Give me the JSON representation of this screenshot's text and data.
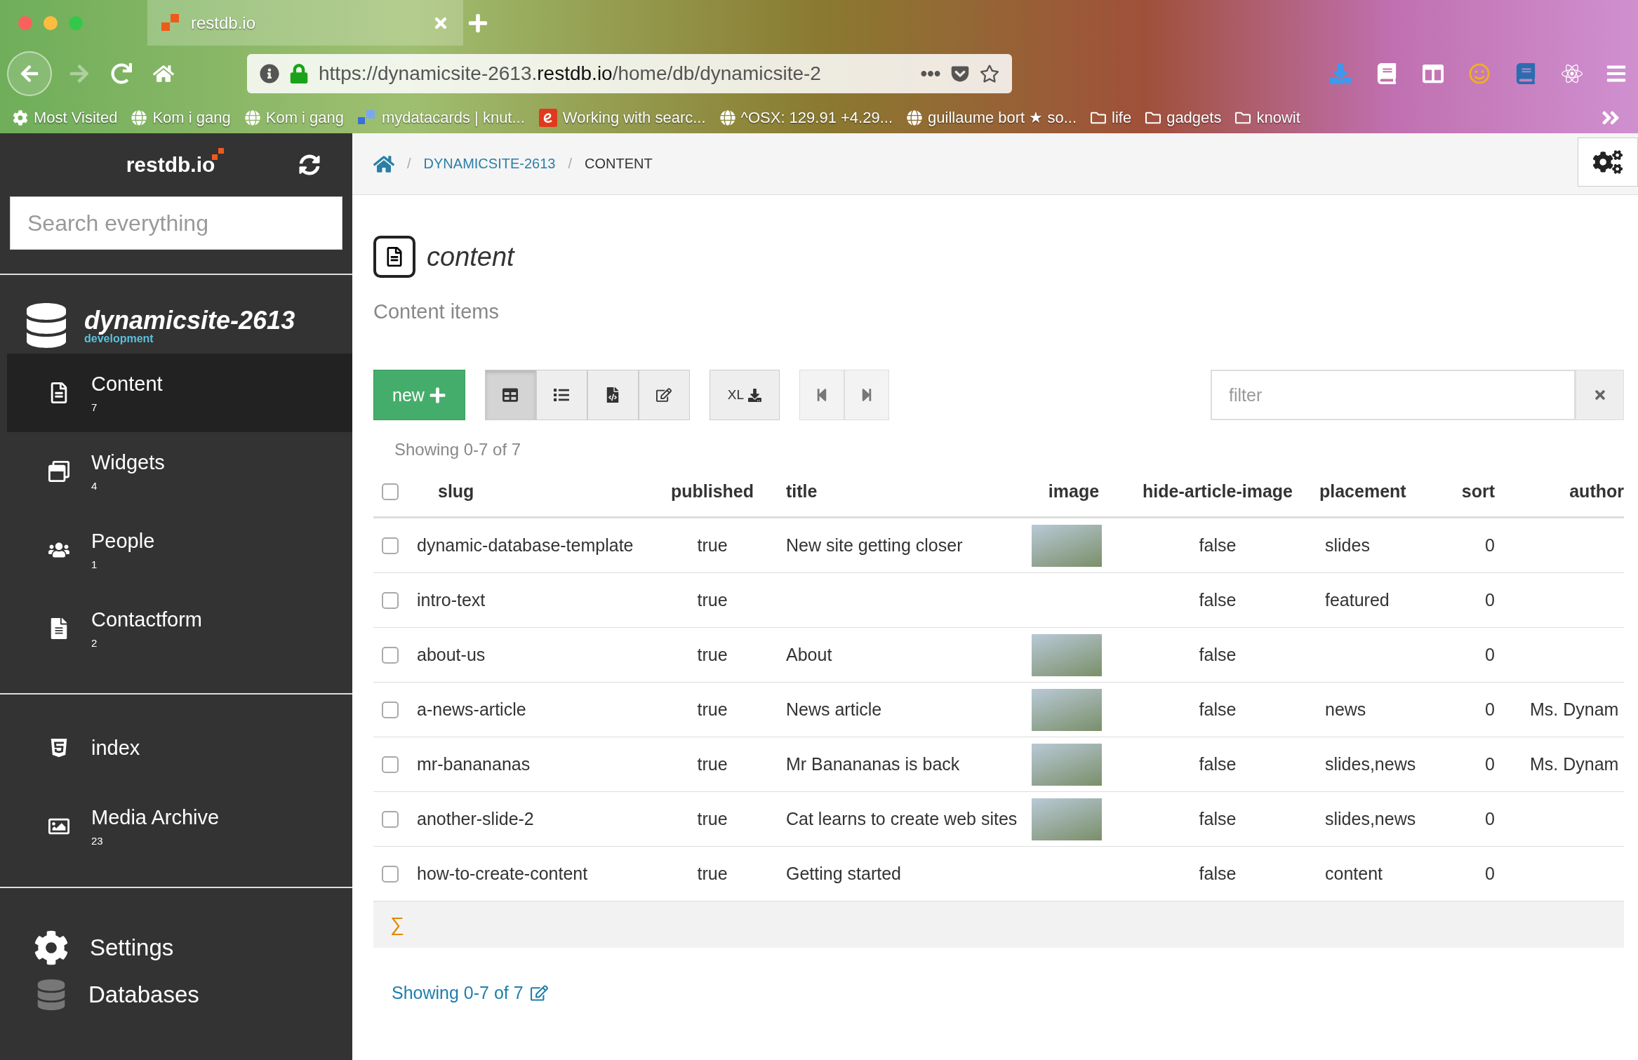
{
  "browser": {
    "tab_title": "restdb.io",
    "url_prefix": "https://dynamicsite-2613.",
    "url_domain": "restdb.io",
    "url_path": "/home/db/dynamicsite-2",
    "bookmarks": [
      {
        "kind": "gear",
        "label": "Most Visited"
      },
      {
        "kind": "globe",
        "label": "Kom i gang"
      },
      {
        "kind": "globe",
        "label": "Kom i gang"
      },
      {
        "kind": "app",
        "label": "mydatacards | knut..."
      },
      {
        "kind": "edit",
        "label": "Working with searc..."
      },
      {
        "kind": "globe",
        "label": "^OSX: 129.91 +4.29..."
      },
      {
        "kind": "globe",
        "label": "guillaume bort ★ so..."
      },
      {
        "kind": "folder",
        "label": "life"
      },
      {
        "kind": "folder",
        "label": "gadgets"
      },
      {
        "kind": "folder",
        "label": "knowit"
      }
    ]
  },
  "sidebar": {
    "logo": "restdb.io",
    "search_placeholder": "Search everything",
    "database": "dynamicsite-2613",
    "environment": "development",
    "collections": [
      {
        "kind": "document",
        "label": "Content",
        "count": "7",
        "selected": true
      },
      {
        "kind": "widgets",
        "label": "Widgets",
        "count": "4",
        "selected": false
      },
      {
        "kind": "people",
        "label": "People",
        "count": "1",
        "selected": false
      },
      {
        "kind": "form",
        "label": "Contactform",
        "count": "2",
        "selected": false
      }
    ],
    "pages": [
      {
        "kind": "html",
        "label": "index"
      },
      {
        "kind": "media",
        "label": "Media Archive",
        "count": "23"
      }
    ],
    "settings": "Settings",
    "databases": "Databases"
  },
  "breadcrumb": [
    "DYNAMICSITE-2613",
    "CONTENT"
  ],
  "breadcrumb_separator": "/",
  "page": {
    "title": "content",
    "subtitle": "Content items"
  },
  "toolbar": {
    "new_label": "new",
    "views": [
      {
        "kind": "table",
        "selected": true
      },
      {
        "kind": "list",
        "selected": false
      },
      {
        "kind": "code",
        "selected": false
      },
      {
        "kind": "edit",
        "selected": false
      }
    ],
    "export_label": "XL",
    "filter_placeholder": "filter"
  },
  "showing": "Showing 0-7 of 7",
  "select_all_checked": false,
  "table": {
    "columns": [
      "slug",
      "published",
      "title",
      "image",
      "hide-article-image",
      "placement",
      "sort",
      "author"
    ],
    "rows": [
      {
        "checked": false,
        "slug": "dynamic-database-template",
        "published": "true",
        "title": "New site getting closer",
        "image": true,
        "hide": "false",
        "placement": "slides",
        "sort": "0",
        "author": ""
      },
      {
        "checked": false,
        "slug": "intro-text",
        "published": "true",
        "title": "",
        "image": false,
        "hide": "false",
        "placement": "featured",
        "sort": "0",
        "author": ""
      },
      {
        "checked": false,
        "slug": "about-us",
        "published": "true",
        "title": "About",
        "image": true,
        "hide": "false",
        "placement": "",
        "sort": "0",
        "author": ""
      },
      {
        "checked": false,
        "slug": "a-news-article",
        "published": "true",
        "title": "News article",
        "image": true,
        "hide": "false",
        "placement": "news",
        "sort": "0",
        "author": "Ms. Dynam"
      },
      {
        "checked": false,
        "slug": "mr-banananas",
        "published": "true",
        "title": "Mr Banananas is back",
        "image": true,
        "hide": "false",
        "placement": "slides,news",
        "sort": "0",
        "author": "Ms. Dynam"
      },
      {
        "checked": false,
        "slug": "another-slide-2",
        "published": "true",
        "title": "Cat learns to create web sites",
        "image": true,
        "hide": "false",
        "placement": "slides,news",
        "sort": "0",
        "author": ""
      },
      {
        "checked": false,
        "slug": "how-to-create-content",
        "published": "true",
        "title": "Getting started",
        "image": false,
        "hide": "false",
        "placement": "content",
        "sort": "0",
        "author": ""
      }
    ],
    "sum_symbol": "∑"
  },
  "footer": "Showing 0-7 of 7"
}
